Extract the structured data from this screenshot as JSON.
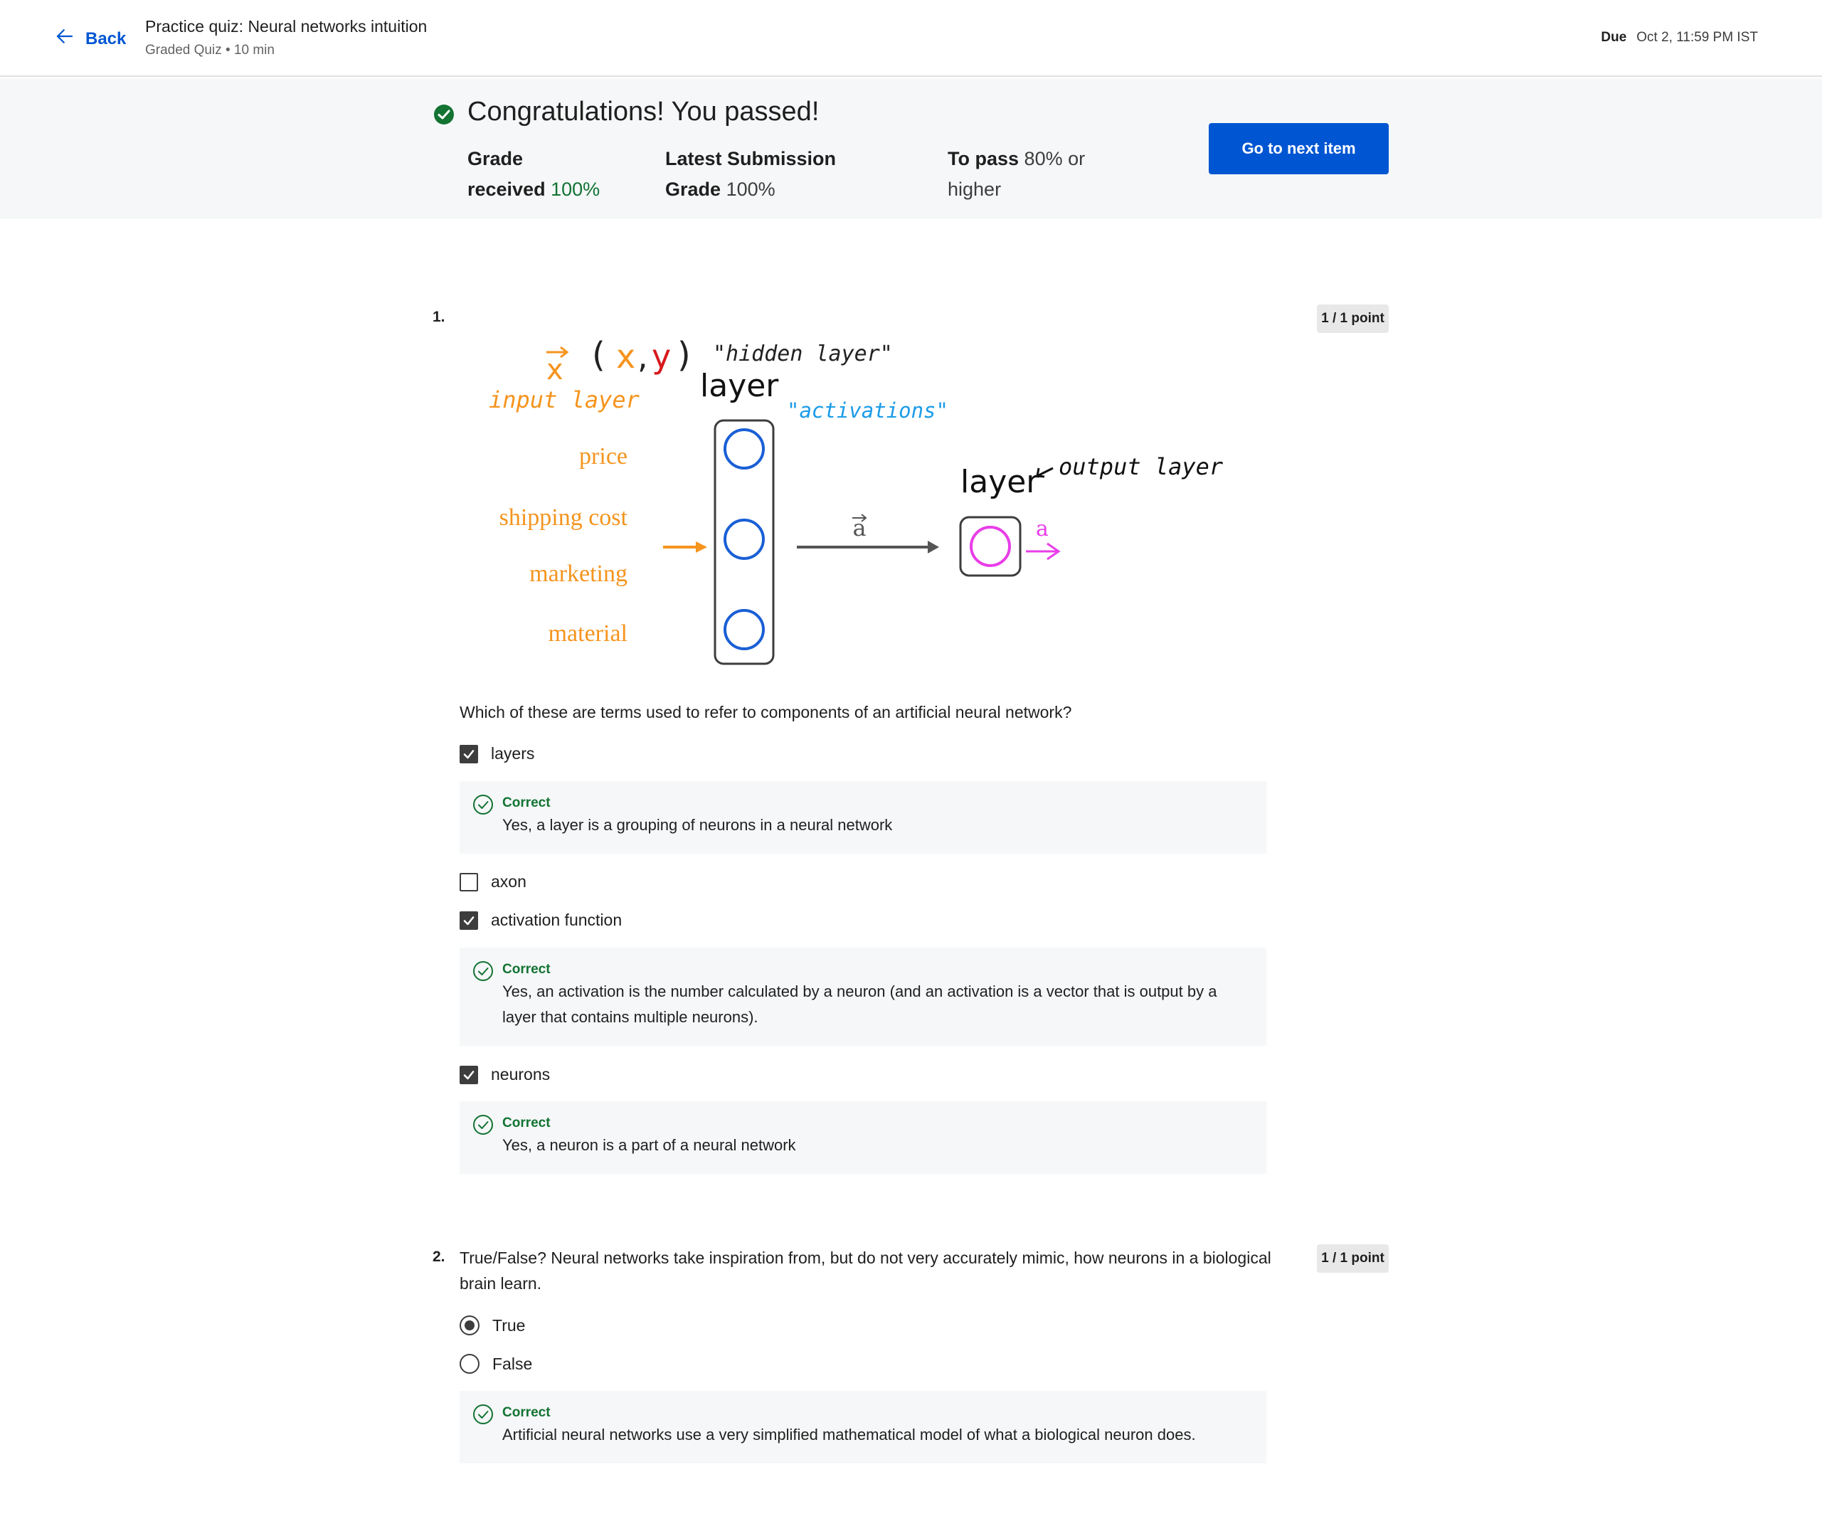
{
  "header": {
    "back_label": "Back",
    "title": "Practice quiz: Neural networks intuition",
    "subtitle": "Graded Quiz • 10 min",
    "due_label": "Due",
    "due_value": "Oct 2, 11:59 PM IST"
  },
  "banner": {
    "title": "Congratulations! You passed!",
    "grade_label_1": "Grade",
    "grade_label_2": "received",
    "grade_value": "100%",
    "latest_label_1": "Latest Submission",
    "latest_label_2": "Grade",
    "latest_value": "100%",
    "pass_label": "To pass",
    "pass_value_1": "80% or",
    "pass_value_2": "higher",
    "next_button": "Go to next item"
  },
  "colors": {
    "accent": "#0056d2",
    "success": "#137333",
    "diagram_orange": "#f5941e",
    "diagram_blue": "#1a5fd6",
    "diagram_pink": "#e83ee8",
    "diagram_cyan": "#1a9be8",
    "diagram_red": "#d7191c"
  },
  "q1": {
    "number": "1.",
    "points": "1 / 1 point",
    "diagram": {
      "x_vec": "x",
      "xy_open": "(",
      "xy_x": "x",
      "xy_comma": ",",
      "xy_y": "y",
      "xy_close": ")",
      "hidden_layer": "\"hidden layer\"",
      "layer_top": "layer",
      "input_layer": "input layer",
      "activations": "\"activations\"",
      "features": [
        "price",
        "shipping cost",
        "marketing",
        "material"
      ],
      "a_vec": "a",
      "layer_right": "layer",
      "output_layer": "output layer",
      "a_out": "a"
    },
    "question": "Which of these are terms used to refer to components of an artificial neural network?",
    "options": [
      {
        "label": "layers",
        "checked": true,
        "feedback_title": "Correct",
        "feedback_text": "Yes, a layer is a grouping of neurons in a neural network"
      },
      {
        "label": "axon",
        "checked": false
      },
      {
        "label": "activation function",
        "checked": true,
        "feedback_title": "Correct",
        "feedback_text_1": "Yes, an activation is the number calculated by a neuron (and an activation is a vector that is output by a",
        "feedback_text_2": "layer that contains multiple neurons)."
      },
      {
        "label": "neurons",
        "checked": true,
        "feedback_title": "Correct",
        "feedback_text": "Yes, a neuron is a part of a neural network"
      }
    ]
  },
  "q2": {
    "number": "2.",
    "points": "1 / 1 point",
    "question_1": "True/False? Neural networks take inspiration from, but do not very accurately mimic, how neurons in a biological",
    "question_2": "brain learn.",
    "options": [
      {
        "label": "True",
        "selected": true
      },
      {
        "label": "False",
        "selected": false
      }
    ],
    "feedback_title": "Correct",
    "feedback_text": "Artificial neural networks use a very simplified mathematical model of what a biological neuron does."
  }
}
